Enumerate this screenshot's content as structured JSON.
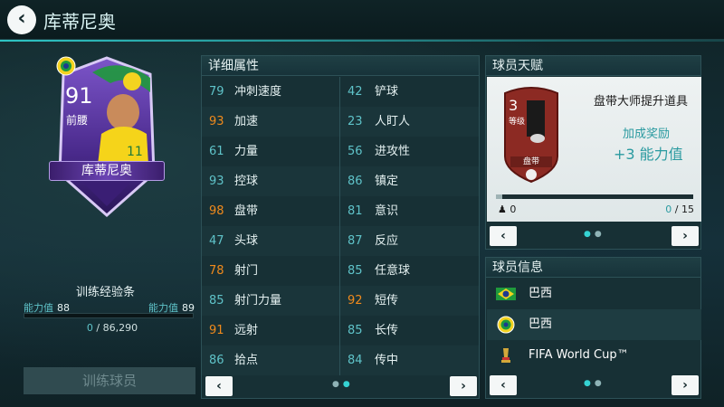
{
  "header": {
    "title": "库蒂尼奥"
  },
  "card": {
    "rating": "91",
    "position": "前腰",
    "name": "库蒂尼奥"
  },
  "training": {
    "label": "训练经验条",
    "level_left_label": "能力值",
    "level_left_value": "88",
    "level_right_label": "能力值",
    "level_right_value": "89",
    "xp_current": "0",
    "xp_total": "/ 86,290",
    "xp_progress": 0.0,
    "button_label": "训练球员"
  },
  "stats": {
    "title": "详细属性",
    "rows": [
      {
        "left": {
          "value": "79",
          "name": "冲刺速度",
          "color": "#5fc3c9"
        },
        "right": {
          "value": "42",
          "name": "铲球",
          "color": "#5fc3c9"
        }
      },
      {
        "left": {
          "value": "93",
          "name": "加速",
          "color": "#f08a1c"
        },
        "right": {
          "value": "23",
          "name": "人盯人",
          "color": "#5fc3c9"
        }
      },
      {
        "left": {
          "value": "61",
          "name": "力量",
          "color": "#5fc3c9"
        },
        "right": {
          "value": "56",
          "name": "进攻性",
          "color": "#5fc3c9"
        }
      },
      {
        "left": {
          "value": "93",
          "name": "控球",
          "color": "#5fc3c9"
        },
        "right": {
          "value": "86",
          "name": "镇定",
          "color": "#5fc3c9"
        }
      },
      {
        "left": {
          "value": "98",
          "name": "盘带",
          "color": "#f08a1c"
        },
        "right": {
          "value": "81",
          "name": "意识",
          "color": "#5fc3c9"
        }
      },
      {
        "left": {
          "value": "47",
          "name": "头球",
          "color": "#5fc3c9"
        },
        "right": {
          "value": "87",
          "name": "反应",
          "color": "#5fc3c9"
        }
      },
      {
        "left": {
          "value": "78",
          "name": "射门",
          "color": "#f08a1c"
        },
        "right": {
          "value": "85",
          "name": "任意球",
          "color": "#5fc3c9"
        }
      },
      {
        "left": {
          "value": "85",
          "name": "射门力量",
          "color": "#5fc3c9"
        },
        "right": {
          "value": "92",
          "name": "短传",
          "color": "#f08a1c"
        }
      },
      {
        "left": {
          "value": "91",
          "name": "远射",
          "color": "#f08a1c"
        },
        "right": {
          "value": "85",
          "name": "长传",
          "color": "#5fc3c9"
        }
      },
      {
        "left": {
          "value": "86",
          "name": "拾点",
          "color": "#5fc3c9"
        },
        "right": {
          "value": "84",
          "name": "传中",
          "color": "#5fc3c9"
        }
      }
    ],
    "prev": "‹",
    "next": "›"
  },
  "talent": {
    "title": "球员天赋",
    "level": "3",
    "level_label": "等级",
    "badge_label": "盘带",
    "name": "盘带大师提升道具",
    "reward_label": "加成奖励",
    "reward_value": "+3 能力值",
    "count_left": "0",
    "count_current": "0",
    "count_total": "/ 15",
    "progress": 0.03,
    "prev": "‹",
    "next": "›"
  },
  "info": {
    "title": "球员信息",
    "rows": [
      {
        "icon": "brazil-flag-icon",
        "text": "巴西"
      },
      {
        "icon": "brazil-badge-icon",
        "text": "巴西"
      },
      {
        "icon": "world-cup-icon",
        "text": "FIFA World Cup™"
      }
    ],
    "prev": "‹",
    "next": "›"
  }
}
